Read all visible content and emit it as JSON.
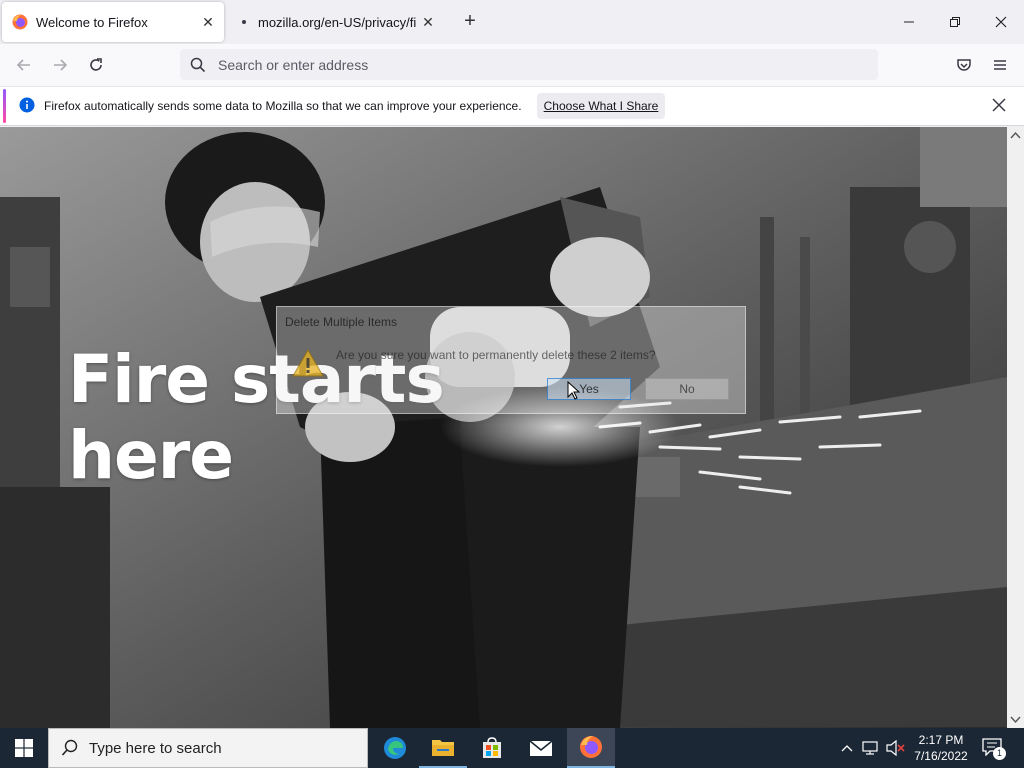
{
  "window": {
    "tabs": [
      {
        "title": "Welcome to Firefox",
        "active": true
      },
      {
        "title": "mozilla.org/en-US/privacy/firefox",
        "active": false
      }
    ]
  },
  "navbar": {
    "address_placeholder": "Search or enter address"
  },
  "notification": {
    "message": "Firefox automatically sends some data to Mozilla so that we can improve your experience.",
    "button_label": "Choose What I Share"
  },
  "page": {
    "hero_line1": "Fire starts",
    "hero_line2": "here"
  },
  "dialog": {
    "title": "Delete Multiple Items",
    "message": "Are you sure you want to permanently delete these 2 items?",
    "yes_label": "Yes",
    "no_label": "No"
  },
  "taskbar": {
    "search_placeholder": "Type here to search",
    "time": "2:17 PM",
    "date": "7/16/2022",
    "notification_count": "1"
  },
  "colors": {
    "accent_blue": "#0060df",
    "taskbar_bg": "#1c2735"
  }
}
